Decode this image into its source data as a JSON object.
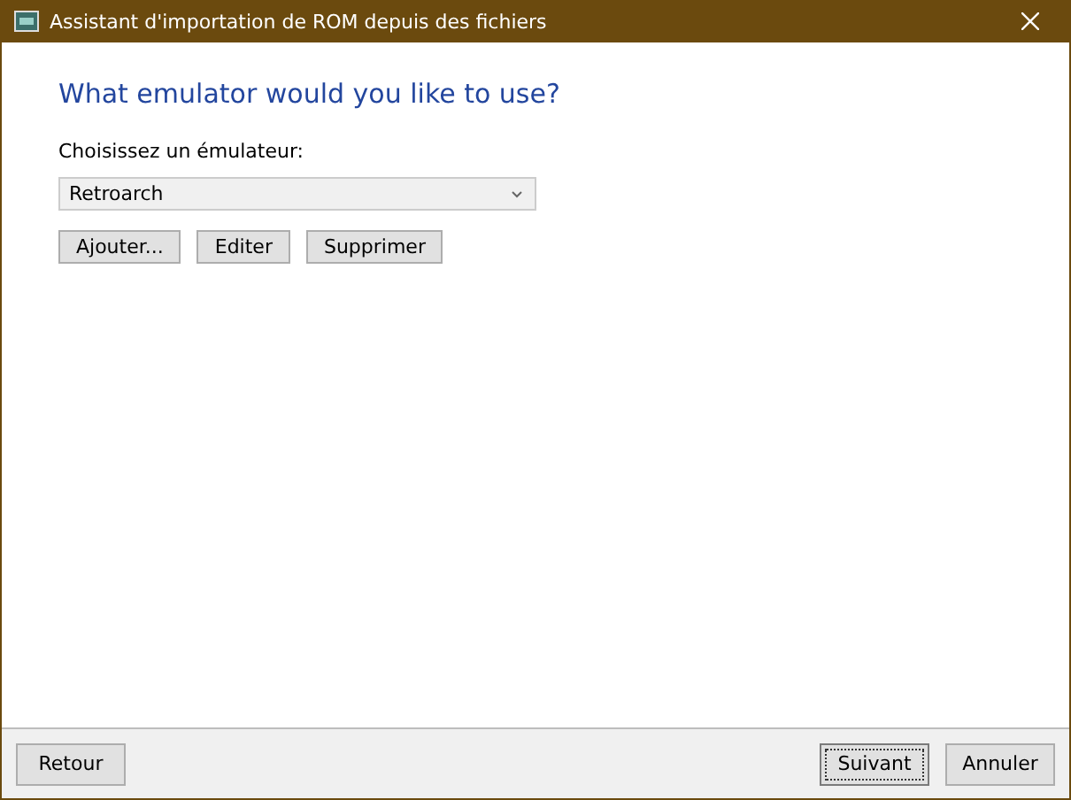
{
  "window": {
    "title": "Assistant d'importation de ROM depuis des fichiers"
  },
  "heading": "What emulator would you like to use?",
  "emulator_label": "Choisissez un émulateur:",
  "emulator_select": {
    "value": "Retroarch"
  },
  "emulator_buttons": [
    "Ajouter...",
    "Editer",
    "Supprimer"
  ],
  "footer_left_buttons": [
    {
      "label": "Retour",
      "focused": false
    }
  ],
  "footer_right_buttons": [
    {
      "label": "Suivant",
      "focused": true
    },
    {
      "label": "Annuler",
      "focused": false
    }
  ]
}
